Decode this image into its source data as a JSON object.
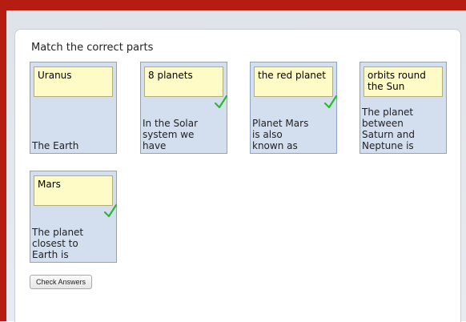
{
  "title": "Match the correct parts",
  "accent_color": "#b51c12",
  "cards": [
    {
      "answer": "Uranus",
      "prompt": "The Earth",
      "correct": false
    },
    {
      "answer": "8 planets",
      "prompt": "In the Solar system we have",
      "correct": true
    },
    {
      "answer": "the red planet",
      "prompt": "Planet Mars is also known as",
      "correct": true
    },
    {
      "answer": "orbits round the Sun",
      "prompt": "The planet between Saturn and Neptune is",
      "correct": false
    },
    {
      "answer": "Mars",
      "prompt": "The planet closest to Earth is",
      "correct": true
    }
  ],
  "check_button": "Check Answers"
}
